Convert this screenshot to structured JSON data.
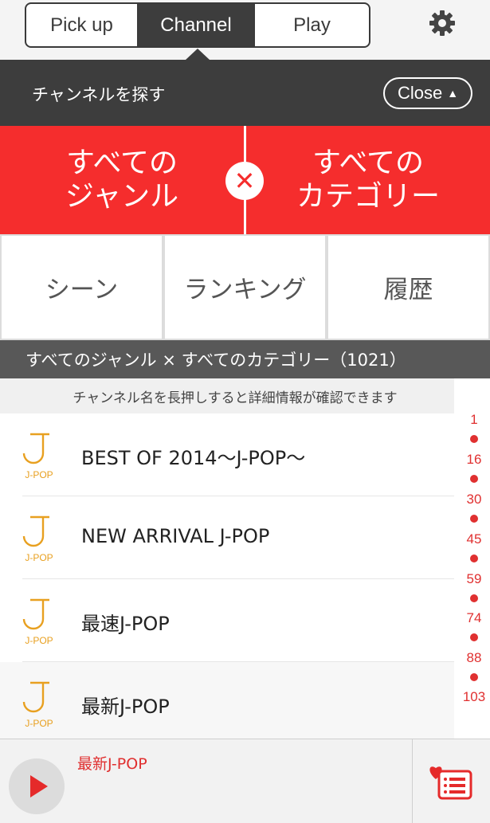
{
  "top_tabs": [
    "Pick up",
    "Channel",
    "Play"
  ],
  "active_tab_index": 1,
  "search_header": {
    "title": "チャンネルを探す",
    "close_label": "Close",
    "close_arrow": "▲"
  },
  "selector": {
    "genre": [
      "すべての",
      "ジャンル"
    ],
    "category": [
      "すべての",
      "カテゴリー"
    ],
    "cross_symbol": "✕"
  },
  "sub_tabs": [
    "シーン",
    "ランキング",
    "履歴"
  ],
  "result_header": "すべてのジャンル × すべてのカテゴリー（1021）",
  "hint": "チャンネル名を長押しすると詳細情報が確認できます",
  "channels": [
    {
      "name": "BEST OF 2014〜J-POP〜",
      "logo_text": "J-POP"
    },
    {
      "name": "NEW ARRIVAL J-POP",
      "logo_text": "J-POP"
    },
    {
      "name": "最速J-POP",
      "logo_text": "J-POP"
    },
    {
      "name": "最新J-POP",
      "logo_text": "J-POP"
    }
  ],
  "index_numbers": [
    "1",
    "16",
    "30",
    "45",
    "59",
    "74",
    "88",
    "103"
  ],
  "player": {
    "now_playing": "最新J-POP"
  },
  "colors": {
    "accent_red": "#f52d2d",
    "dark_header": "#3d3d3d",
    "logo_orange": "#e8a020"
  }
}
